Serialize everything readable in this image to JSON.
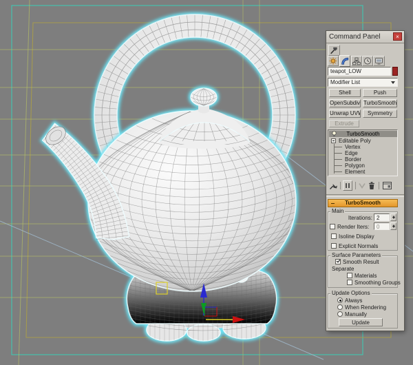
{
  "window": {
    "title": "Command Panel",
    "close_glyph": "×"
  },
  "tabs": {
    "utilities": "utilities-hammer",
    "create": "create-sun",
    "modify": "modify-curve",
    "hierarchy": "hierarchy-boxes",
    "motion": "motion-clock",
    "display": "display-monitor",
    "active_tab": "modify"
  },
  "object_name": "teapot_LOW",
  "modifier_list": {
    "label": "Modifier List"
  },
  "modifier_buttons": [
    {
      "label": "Shell"
    },
    {
      "label": "Push"
    },
    {
      "label": "OpenSubdiv"
    },
    {
      "label": "TurboSmooth"
    },
    {
      "label": "Unwrap UVW"
    },
    {
      "label": "Symmetry"
    }
  ],
  "extrude_button": {
    "label": "Extrude",
    "disabled": true
  },
  "stack": {
    "items": [
      {
        "label": "TurboSmooth",
        "selected": true,
        "icon": "lightbulb-icon"
      },
      {
        "label": "Editable Poly",
        "expanded": true
      },
      {
        "label": "Vertex"
      },
      {
        "label": "Edge"
      },
      {
        "label": "Border"
      },
      {
        "label": "Polygon"
      },
      {
        "label": "Element"
      }
    ]
  },
  "stack_toolbar": [
    "pin-stack-icon",
    "show-end-result-icon",
    "make-unique-icon",
    "remove-modifier-icon",
    "configure-modifier-sets-icon"
  ],
  "rollout": {
    "title": "TurboSmooth",
    "main": {
      "label": "Main",
      "iterations_label": "Iterations:",
      "iterations_value": "2",
      "render_iters_label": "Render Iters:",
      "render_iters_value": "0",
      "render_iters_checked": false,
      "isoline_label": "Isoline Display",
      "isoline_checked": false,
      "explicit_label": "Explicit Normals",
      "explicit_checked": false
    },
    "surface": {
      "label": "Surface Parameters",
      "smooth_result_label": "Smooth Result",
      "smooth_result_checked": true,
      "separate_label": "Separate",
      "materials_label": "Materials",
      "materials_checked": false,
      "smoothing_groups_label": "Smoothing Groups",
      "smoothing_groups_checked": false
    },
    "update": {
      "label": "Update Options",
      "options": [
        {
          "label": "Always",
          "selected": true
        },
        {
          "label": "When Rendering",
          "selected": false
        },
        {
          "label": "Manually",
          "selected": false
        }
      ],
      "button_label": "Update"
    }
  },
  "colors": {
    "viewport_bg": "#7e7e7e",
    "selection_glow": "#49d8ef",
    "selection_glow_bright": "#8df2ff",
    "rim_white": "#eefdff",
    "grid_teal": "#46c0ae",
    "grid_olive": "#a59a4e",
    "grid_yellow": "#bcc763",
    "grid_blue": "#a3bdd1",
    "wire": "#666666",
    "axis_x_red": "#cc1111",
    "axis_y_green": "#0c9c22",
    "axis_z_blue": "#2a2ad0",
    "gizmo_yellow": "#ddcf2a",
    "object_color_swatch": "#9b2423",
    "rollout_header": "#eca43c"
  }
}
